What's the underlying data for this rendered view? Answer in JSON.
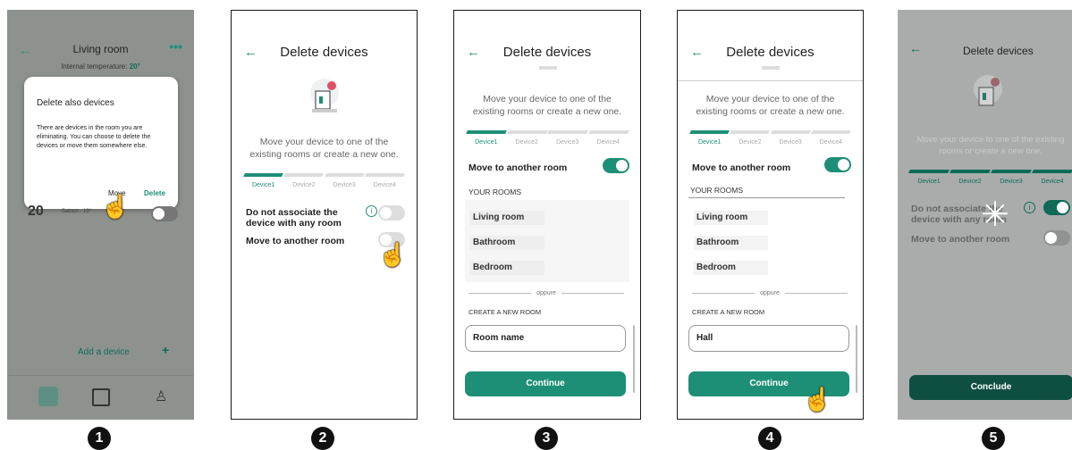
{
  "screen1": {
    "title": "Living room",
    "menu_icon": "•••",
    "temperature_label": "Internal temperature:",
    "temperature_value": "20°",
    "dialog": {
      "title": "Delete also devices",
      "body": "There are devices in the room you are eliminating. You can choose to delete the devices or move them somewhere else.",
      "move_label": "Move",
      "delete_label": "Delete"
    },
    "big_number": "20",
    "room_sub": "Saloon - 19°",
    "add_device_label": "Add a device",
    "add_icon": "+",
    "nav": [
      "home-icon",
      "calendar-icon",
      "user-icon"
    ],
    "step_number": "1"
  },
  "screen2": {
    "title": "Delete devices",
    "intro": "Move your device to one of the existing rooms or create a new one.",
    "steps": [
      "Device1",
      "Device2",
      "Device3",
      "Device4"
    ],
    "no_assoc_label": "Do not associate the device with any room",
    "move_label": "Move to another room",
    "step_number": "2"
  },
  "screen3": {
    "title": "Delete devices",
    "intro": "Move your device to one of the existing rooms or create a new one.",
    "steps": [
      "Device1",
      "Device2",
      "Device3",
      "Device4"
    ],
    "move_label": "Move to another room",
    "rooms_header": "YOUR ROOMS",
    "rooms": [
      "Living room",
      "Bathroom",
      "Bedroom"
    ],
    "or_label": "oppure",
    "create_header": "CREATE A NEW ROOM",
    "room_placeholder": "Room name",
    "continue_label": "Continue",
    "step_number": "3"
  },
  "screen4": {
    "title": "Delete devices",
    "intro": "Move your device to one of the existing rooms or create a new one.",
    "steps": [
      "Device1",
      "Device2",
      "Device3",
      "Device4"
    ],
    "move_label": "Move to another room",
    "rooms_header": "YOUR ROOMS",
    "rooms": [
      "Living room",
      "Bathroom",
      "Bedroom"
    ],
    "or_label": "oppure",
    "create_header": "CREATE A NEW ROOM",
    "room_value": "Hall",
    "continue_label": "Continue",
    "step_number": "4"
  },
  "screen5": {
    "title": "Delete devices",
    "intro": "Move your device to one of the existing rooms or create a new one.",
    "steps": [
      "Device1",
      "Device2",
      "Device3",
      "Device4"
    ],
    "no_assoc_label": "Do not associate the device with any room",
    "move_label": "Move to another room",
    "conclude_label": "Conclude",
    "step_number": "5"
  },
  "colors": {
    "accent": "#1e8f77",
    "dim_overlay": "#8e928e",
    "dark_button": "#0f4f42"
  }
}
